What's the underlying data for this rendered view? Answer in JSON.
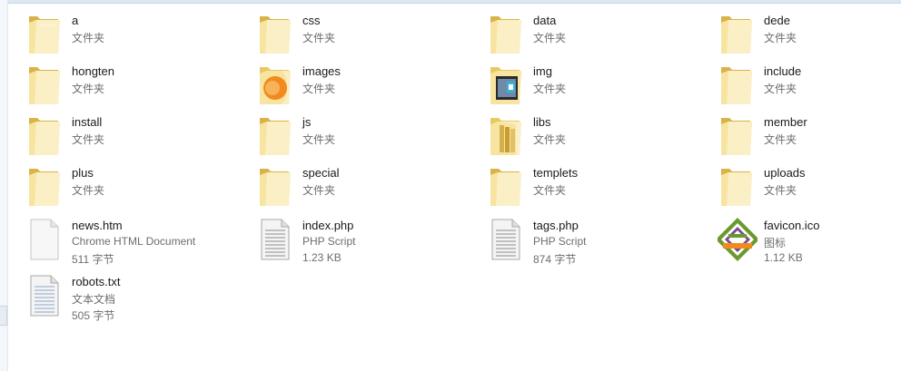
{
  "folders": [
    {
      "name": "a",
      "type": "文件夹"
    },
    {
      "name": "css",
      "type": "文件夹"
    },
    {
      "name": "data",
      "type": "文件夹"
    },
    {
      "name": "dede",
      "type": "文件夹"
    },
    {
      "name": "hongten",
      "type": "文件夹"
    },
    {
      "name": "images",
      "type": "文件夹"
    },
    {
      "name": "img",
      "type": "文件夹"
    },
    {
      "name": "include",
      "type": "文件夹"
    },
    {
      "name": "install",
      "type": "文件夹"
    },
    {
      "name": "js",
      "type": "文件夹"
    },
    {
      "name": "libs",
      "type": "文件夹"
    },
    {
      "name": "member",
      "type": "文件夹"
    },
    {
      "name": "plus",
      "type": "文件夹"
    },
    {
      "name": "special",
      "type": "文件夹"
    },
    {
      "name": "templets",
      "type": "文件夹"
    },
    {
      "name": "uploads",
      "type": "文件夹"
    }
  ],
  "files": [
    {
      "name": "news.htm",
      "type": "Chrome HTML Document",
      "size": "511 字节",
      "icon": "html-document-icon"
    },
    {
      "name": "index.php",
      "type": "PHP Script",
      "size": "1.23 KB",
      "icon": "text-document-icon"
    },
    {
      "name": "tags.php",
      "type": "PHP Script",
      "size": "874 字节",
      "icon": "text-document-icon"
    },
    {
      "name": "favicon.ico",
      "type": "图标",
      "size": "1.12 KB",
      "icon": "favicon-icon"
    },
    {
      "name": "robots.txt",
      "type": "文本文档",
      "size": "505 字节",
      "icon": "text-document-icon"
    }
  ],
  "colors": {
    "folder": "#f5dc8a",
    "folder_light": "#fbefc0",
    "orange": "#f28a1e"
  }
}
